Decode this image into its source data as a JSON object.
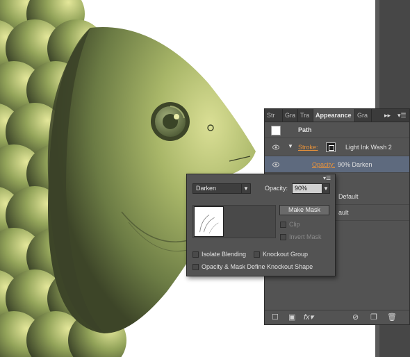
{
  "appearance_panel": {
    "tabs": [
      "Str",
      "Gra",
      "Tra",
      "Appearance",
      "Gra"
    ],
    "active_tab": "Appearance",
    "collapse_icon": "double-chevron-right-icon",
    "menu_icon": "panel-menu-icon",
    "object_label": "Path",
    "stroke_label": "Stroke:",
    "stroke_value": "Light Ink Wash 2",
    "opacity_label": "Opacity:",
    "opacity_value": "90% Darken",
    "row_default_1": "Default",
    "row_default_2": "ault",
    "bottom_icons": [
      "new-square-icon",
      "stroke-square-icon",
      "fx-icon",
      "clear-icon",
      "duplicate-icon",
      "trash-icon"
    ],
    "fx_label": "fx"
  },
  "transparency_popup": {
    "blend_mode": "Darken",
    "opacity_label": "Opacity:",
    "opacity_value": "90%",
    "make_mask_label": "Make Mask",
    "clip_label": "Clip",
    "invert_mask_label": "Invert Mask",
    "isolate_blending_label": "Isolate Blending",
    "knockout_group_label": "Knockout Group",
    "opacity_mask_knockout_label": "Opacity & Mask Define Knockout Shape"
  },
  "colors": {
    "panel_bg": "#535353",
    "selected_row": "#5e6a7e",
    "link_orange": "#e8923a",
    "fish_green": "#8a9a55"
  }
}
